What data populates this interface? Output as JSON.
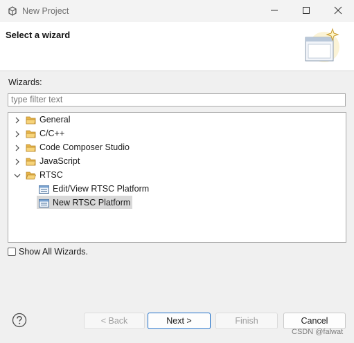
{
  "window": {
    "title": "New Project",
    "app_icon": "eclipse-gear-icon",
    "minimize_icon": "minimize-icon",
    "maximize_icon": "maximize-icon",
    "close_icon": "close-icon"
  },
  "banner": {
    "title": "Select a wizard",
    "image": "wizard-banner-icon"
  },
  "wizards": {
    "label": "Wizards:",
    "filter_placeholder": "type filter text",
    "tree": [
      {
        "label": "General",
        "expanded": false,
        "icon": "folder-icon"
      },
      {
        "label": "C/C++",
        "expanded": false,
        "icon": "folder-icon"
      },
      {
        "label": "Code Composer Studio",
        "expanded": false,
        "icon": "folder-icon"
      },
      {
        "label": "JavaScript",
        "expanded": false,
        "icon": "folder-icon"
      },
      {
        "label": "RTSC",
        "expanded": true,
        "icon": "folder-icon",
        "children": [
          {
            "label": "Edit/View RTSC Platform",
            "icon": "rtsc-platform-icon",
            "selected": false
          },
          {
            "label": "New RTSC Platform",
            "icon": "rtsc-platform-icon",
            "selected": true
          }
        ]
      }
    ],
    "show_all_label": "Show All Wizards.",
    "show_all_checked": false
  },
  "buttons": {
    "help_icon": "help-icon",
    "back": "< Back",
    "next": "Next >",
    "finish": "Finish",
    "cancel": "Cancel"
  },
  "watermark": "CSDN @falwat",
  "colors": {
    "selection": "#d9d9d9",
    "default_button_border": "#1d6fc9",
    "folder": "#e8b548"
  }
}
